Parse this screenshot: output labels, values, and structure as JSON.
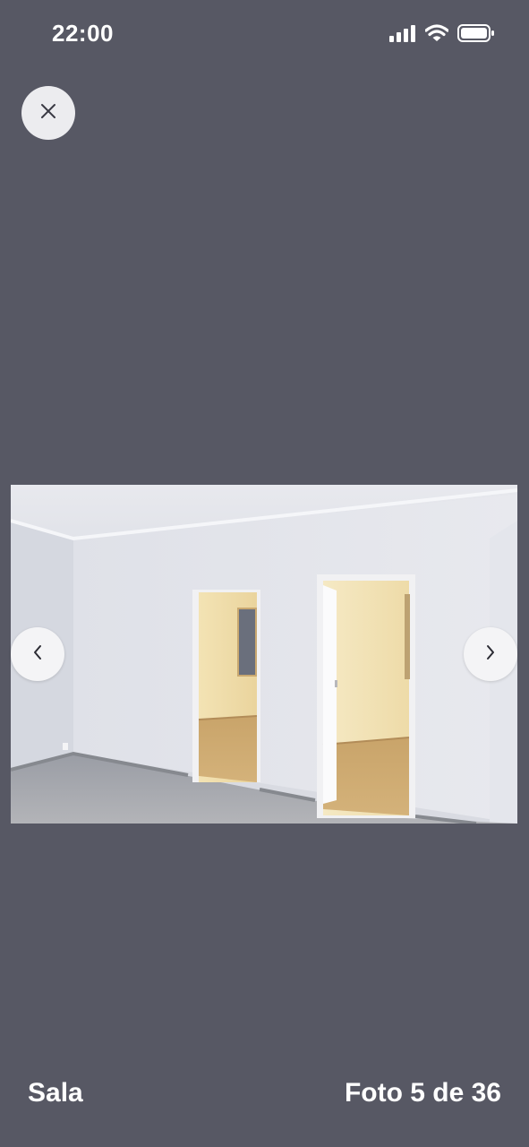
{
  "status_bar": {
    "time": "22:00",
    "icons": [
      "cellular-signal-icon",
      "wifi-icon",
      "battery-icon"
    ]
  },
  "viewer": {
    "close_icon": "close-icon",
    "prev_icon": "chevron-left-icon",
    "next_icon": "chevron-right-icon",
    "photo": {
      "description": "empty room with white walls, wooden floor and two open doorways"
    }
  },
  "footer": {
    "caption": "Sala",
    "counter": "Foto 5 de 36"
  },
  "colors": {
    "background": "#575864",
    "button": "#ececef",
    "text": "#ffffff"
  }
}
